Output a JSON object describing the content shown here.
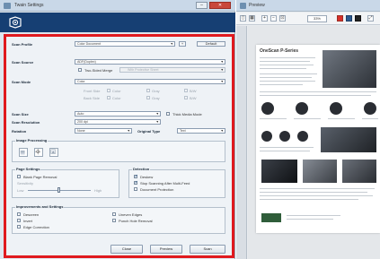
{
  "settings_window": {
    "title": "Twain Settings",
    "profile_label": "Scan Profile",
    "profile_value": "Color Document",
    "add_label": "+",
    "default_label": "Default",
    "source_label": "Scan Source",
    "source_value": "ADF(Duplex)",
    "two_sided_label": "Two-Sided Merge",
    "protective_sheet_label": "With Protective Sheet",
    "mode_label": "Scan Mode",
    "mode_value": "Color",
    "front_side_label": "Front Side",
    "back_side_label": "Back Side",
    "color_label": "Color",
    "gray_label": "Gray",
    "bw_label": "B/W",
    "size_label": "Scan Size",
    "size_value": "Auto",
    "thick_media_label": "Thick Media Mode",
    "resolution_label": "Scan Resolution",
    "resolution_value": "200 dpi",
    "rotation_label": "Rotation",
    "rotation_value": "None",
    "original_type_label": "Original Type",
    "original_type_value": "Text",
    "image_processing_title": "Image Processing",
    "page_settings_title": "Page Settings",
    "blank_page_label": "Blank Page Removal",
    "sensitivity_label": "Sensitivity",
    "slider_low_label": "Low",
    "slider_high_label": "High",
    "detection_title": "Detection",
    "deskew_label": "Deskew",
    "stop_scanning_label": "Stop Scanning After Multi-Feed",
    "document_protection_label": "Document Protection",
    "improvements_title": "Improvements and Settings",
    "descreen_label": "Descreen",
    "invert_label": "Invert",
    "edge_correction_label": "Edge Correction",
    "uneven_edges_label": "Uneven Edges",
    "punch_hole_label": "Punch Hole Removal",
    "close_label": "Close",
    "preview_label": "Preview",
    "scan_label": "Scan"
  },
  "preview_window": {
    "title": "Preview",
    "zoom_value": "33%",
    "doc_title": "OneScan P-Series"
  },
  "colors": {
    "banner": "#163f73",
    "highlight_frame": "#e0191e",
    "window_bg": "#dfe6ee"
  }
}
